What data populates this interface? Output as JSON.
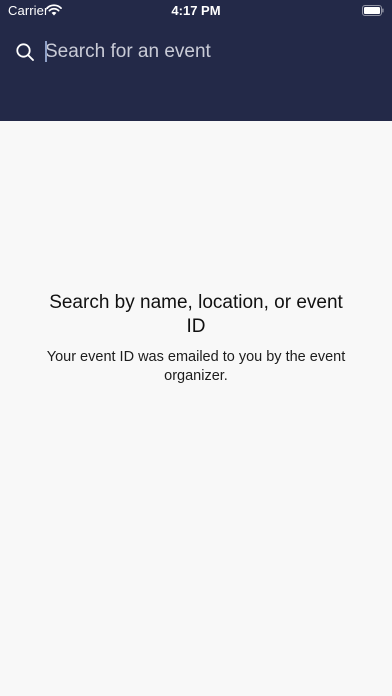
{
  "status_bar": {
    "carrier": "Carrier",
    "time": "4:17 PM"
  },
  "search": {
    "placeholder": "Search for an event"
  },
  "empty_state": {
    "title": "Search by name, location, or event ID",
    "subtitle": "Your event ID was emailed to you by the event organizer."
  },
  "colors": {
    "header_bg": "#232948",
    "page_bg": "#f8f8f8",
    "text": "#111111"
  },
  "icons": [
    "wifi-icon",
    "battery-icon",
    "search-icon"
  ]
}
